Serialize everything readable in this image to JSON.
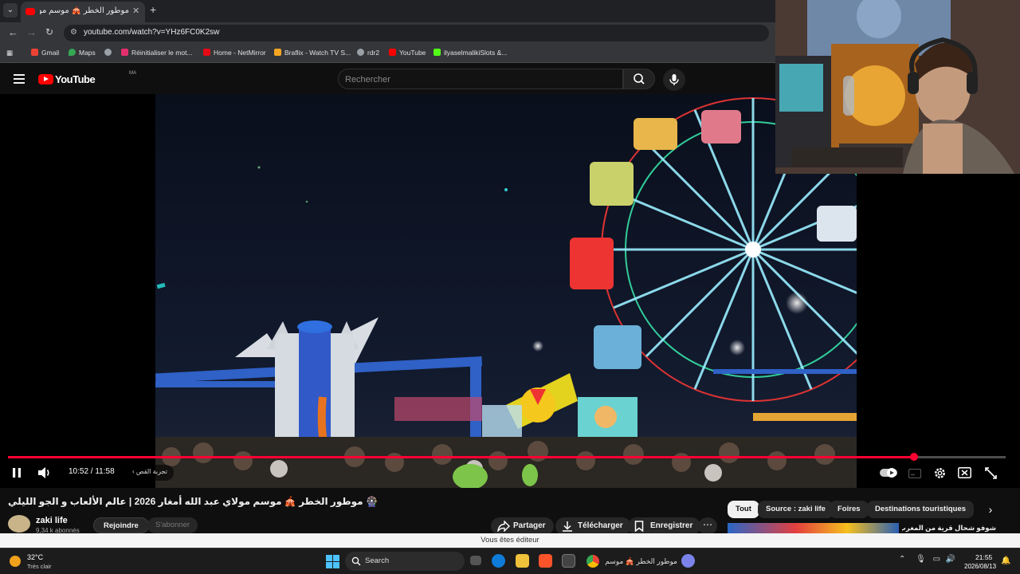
{
  "browser": {
    "tab_title": "موطور الخطر 🎪 موسم مول",
    "url": "youtube.com/watch?v=YHz6FC0K2sw",
    "bookmarks": [
      {
        "label": "Gmail",
        "color": "#ea4335"
      },
      {
        "label": "Maps",
        "color": "#34a853"
      },
      {
        "label": "",
        "color": "#9aa0a6"
      },
      {
        "label": "Réinitialiser le mot...",
        "color": "#e1306c"
      },
      {
        "label": "Home - NetMirror",
        "color": "#e50914"
      },
      {
        "label": "Braflix - Watch TV S...",
        "color": "#f5a623"
      },
      {
        "label": "rdr2",
        "color": "#9aa0a6"
      },
      {
        "label": "YouTube",
        "color": "#ff0000"
      },
      {
        "label": "ilyaselmalikiSlots &...",
        "color": "#53fc18"
      }
    ]
  },
  "youtube": {
    "logo_text": "YouTube",
    "region": "MA",
    "search_placeholder": "Rechercher"
  },
  "player": {
    "time": "10:52 / 11:58",
    "progress_fraction": 0.908,
    "chapter": "تجربة القص ›"
  },
  "video": {
    "title": "🎡 موطور الخطر 🎪 موسم مولاي عبد الله أمغار 2026 | عالم الألعاب و الجو الليلي",
    "channel_name": "zaki life",
    "subscribers": "9,34 k abonnés",
    "join_label": "Rejoindre",
    "subscribe_label": "S'abonner",
    "share_label": "Partager",
    "download_label": "Télécharger",
    "save_label": "Enregistrer"
  },
  "chips": [
    "Tout",
    "Source : zaki life",
    "Foires",
    "Destinations touristiques"
  ],
  "recommendation": {
    "title": "شوفو شحال قرية من المغرب! جزيرة"
  },
  "editor_banner": "Vous êtes éditeur",
  "taskbar": {
    "weather_temp": "32°C",
    "weather_desc": "Très clair",
    "search_label": "Search",
    "chrome_window_title": "موطور الخطر 🎪 موسم مول",
    "clock_time": "21:55",
    "clock_date": "2026/08/13"
  },
  "colors": {
    "accent_red": "#ff0033",
    "youtube_red": "#ff0000"
  }
}
